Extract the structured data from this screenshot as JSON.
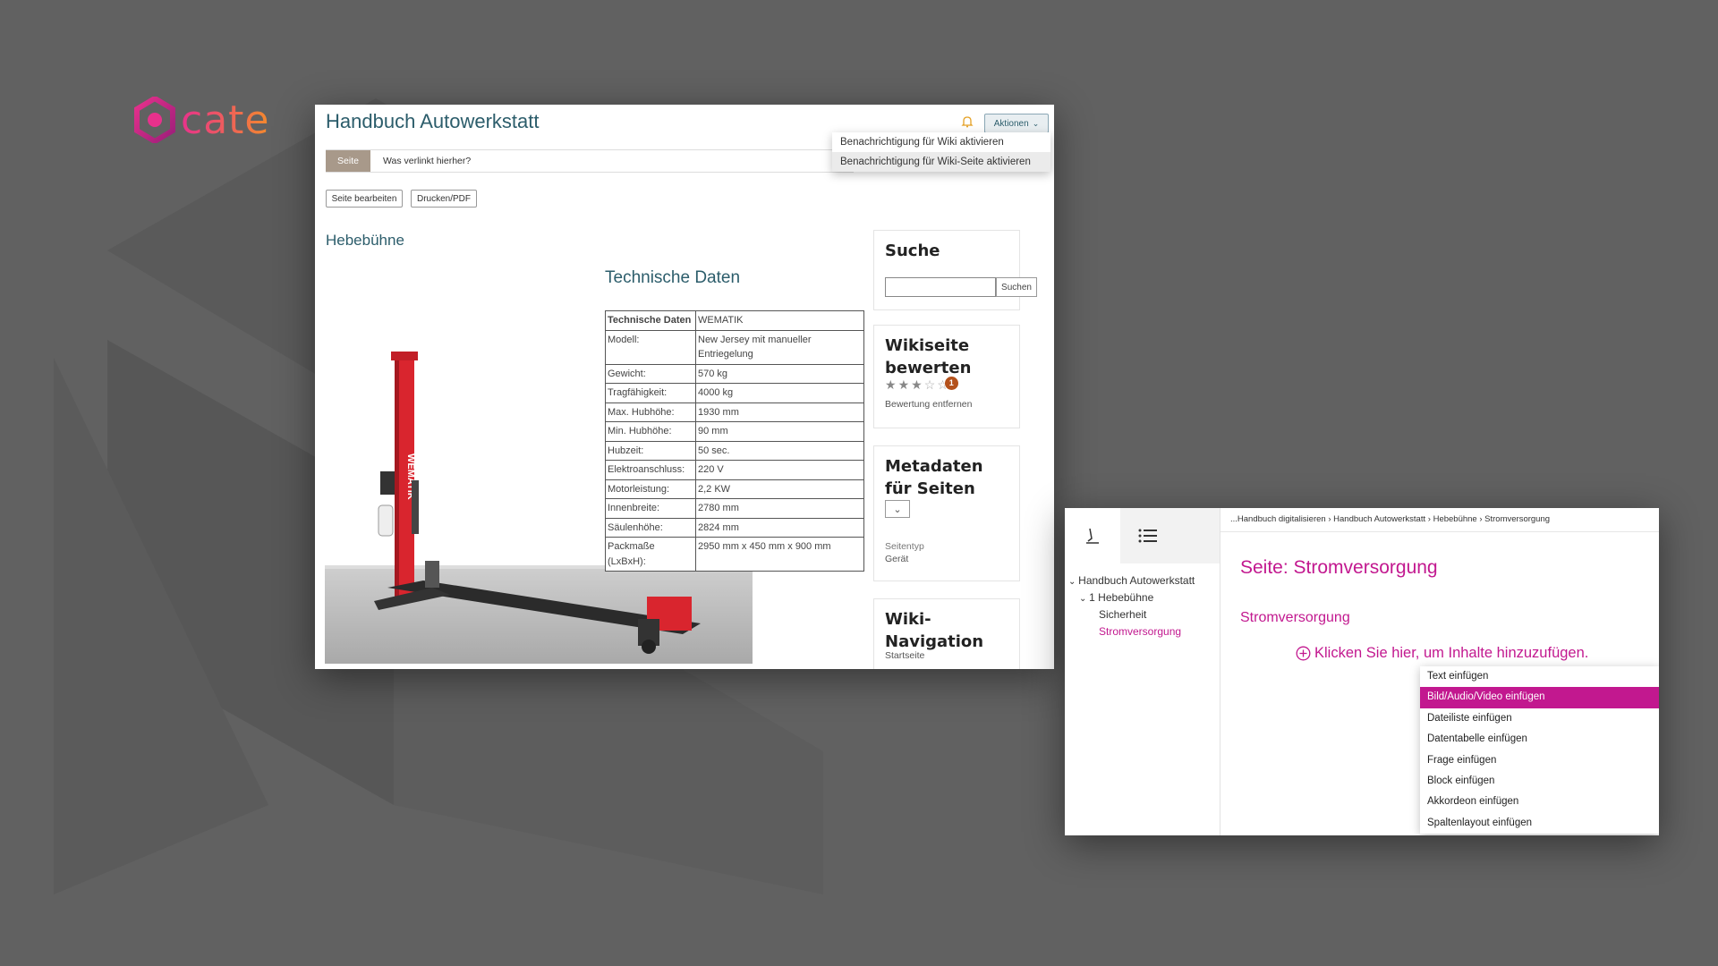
{
  "brand": {
    "logo_text": "cate"
  },
  "wiki": {
    "title": "Handbuch Autowerkstatt",
    "actions_label": "Aktionen",
    "actions_menu": [
      "Benachrichtigung für Wiki aktivieren",
      "Benachrichtigung für Wiki-Seite aktivieren"
    ],
    "tabs": {
      "active": "Seite",
      "other": "Was verlinkt hierher?"
    },
    "buttons": {
      "edit": "Seite bearbeiten",
      "print": "Drucken/PDF"
    },
    "page_heading": "Hebebühne",
    "section_heading": "Technische Daten",
    "specs": [
      {
        "k": "Technische Daten",
        "v": "WEMATIK"
      },
      {
        "k": "Modell:",
        "v": "New Jersey mit manueller Entriegelung"
      },
      {
        "k": "Gewicht:",
        "v": "570 kg"
      },
      {
        "k": "Tragfähigkeit:",
        "v": "4000 kg"
      },
      {
        "k": "Max. Hubhöhe:",
        "v": "1930 mm"
      },
      {
        "k": "Min. Hubhöhe:",
        "v": "90 mm"
      },
      {
        "k": "Hubzeit:",
        "v": "50 sec."
      },
      {
        "k": "Elektroanschluss:",
        "v": "220 V"
      },
      {
        "k": "Motorleistung:",
        "v": "2,2 KW"
      },
      {
        "k": "Innenbreite:",
        "v": "2780 mm"
      },
      {
        "k": "Säulenhöhe:",
        "v": "2824 mm"
      },
      {
        "k": "Packmaße (LxBxH):",
        "v": "2950 mm x 450 mm x 900 mm"
      }
    ],
    "photo_brand": "WEMATIK",
    "sidebar": {
      "search": {
        "title": "Suche",
        "button": "Suchen"
      },
      "rating": {
        "title": "Wikiseite bewerten",
        "stars": 3,
        "max": 5,
        "count": "1",
        "remove": "Bewertung entfernen"
      },
      "meta": {
        "title": "Metadaten für Seiten",
        "field_label": "Seitentyp",
        "field_value": "Gerät"
      },
      "nav": {
        "title": "Wiki-Navigation",
        "first": "Startseite"
      }
    }
  },
  "cate": {
    "breadcrumb": [
      "...Handbuch digitalisieren",
      "Handbuch Autowerkstatt",
      "Hebebühne",
      "Stromversorgung"
    ],
    "tree": [
      "Handbuch Autowerkstatt",
      "1 Hebebühne",
      "Sicherheit",
      "Stromversorgung"
    ],
    "page_title": "Seite: Stromversorgung",
    "section_title": "Stromversorgung",
    "add_prompt": "Klicken Sie hier, um Inhalte hinzuzufügen.",
    "insert_menu": [
      "Text einfügen",
      "Bild/Audio/Video einfügen",
      "Dateiliste einfügen",
      "Datentabelle einfügen",
      "Frage einfügen",
      "Block einfügen",
      "Akkordeon einfügen",
      "Spaltenlayout einfügen"
    ],
    "colors": {
      "accent": "#c2188f"
    }
  }
}
